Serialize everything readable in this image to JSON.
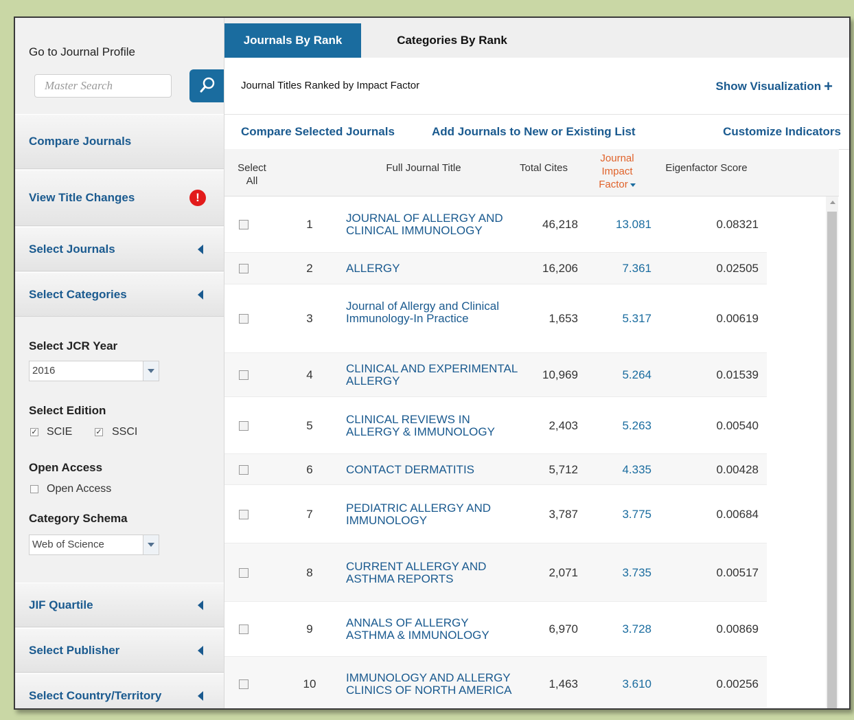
{
  "sidebar": {
    "goto_label": "Go to Journal Profile",
    "search_placeholder": "Master Search",
    "compare": "Compare Journals",
    "title_changes": "View Title Changes",
    "select_journals": "Select Journals",
    "select_categories": "Select Categories",
    "jcr_year_label": "Select JCR Year",
    "jcr_year_value": "2016",
    "edition_label": "Select Edition",
    "edition_scie": "SCIE",
    "edition_ssci": "SSCI",
    "open_access_label": "Open Access",
    "open_access_option": "Open Access",
    "schema_label": "Category Schema",
    "schema_value": "Web of Science",
    "jif_quartile": "JIF Quartile",
    "select_publisher": "Select Publisher",
    "select_country": "Select Country/Territory",
    "icons": {
      "search": "search-icon",
      "alert": "alert-icon",
      "collapse": "collapse-arrow-icon"
    }
  },
  "tabs": {
    "active": "Journals By Rank",
    "other": "Categories By Rank"
  },
  "subheader": {
    "title": "Journal Titles Ranked by Impact Factor",
    "show_vis": "Show Visualization"
  },
  "actions": {
    "compare_selected": "Compare Selected Journals",
    "add_to_list": "Add Journals to New or Existing List",
    "customize": "Customize Indicators"
  },
  "table": {
    "headers": {
      "select_all": "Select All",
      "title": "Full Journal Title",
      "cites": "Total Cites",
      "jif": "Journal Impact Factor",
      "eigen": "Eigenfactor Score"
    },
    "rows": [
      {
        "rank": "1",
        "title": "JOURNAL OF ALLERGY AND CLINICAL IMMUNOLOGY",
        "cites": "46,218",
        "jif": "13.081",
        "eigen": "0.08321"
      },
      {
        "rank": "2",
        "title": "ALLERGY",
        "cites": "16,206",
        "jif": "7.361",
        "eigen": "0.02505"
      },
      {
        "rank": "3",
        "title": "Journal of Allergy and Clinical Immunology-In Practice",
        "cites": "1,653",
        "jif": "5.317",
        "eigen": "0.00619"
      },
      {
        "rank": "4",
        "title": "CLINICAL AND EXPERIMENTAL ALLERGY",
        "cites": "10,969",
        "jif": "5.264",
        "eigen": "0.01539"
      },
      {
        "rank": "5",
        "title": "CLINICAL REVIEWS IN ALLERGY & IMMUNOLOGY",
        "cites": "2,403",
        "jif": "5.263",
        "eigen": "0.00540"
      },
      {
        "rank": "6",
        "title": "CONTACT DERMATITIS",
        "cites": "5,712",
        "jif": "4.335",
        "eigen": "0.00428"
      },
      {
        "rank": "7",
        "title": "PEDIATRIC ALLERGY AND IMMUNOLOGY",
        "cites": "3,787",
        "jif": "3.775",
        "eigen": "0.00684"
      },
      {
        "rank": "8",
        "title": "CURRENT ALLERGY AND ASTHMA REPORTS",
        "cites": "2,071",
        "jif": "3.735",
        "eigen": "0.00517"
      },
      {
        "rank": "9",
        "title": "ANNALS OF ALLERGY ASTHMA & IMMUNOLOGY",
        "cites": "6,970",
        "jif": "3.728",
        "eigen": "0.00869"
      },
      {
        "rank": "10",
        "title": "IMMUNOLOGY AND ALLERGY CLINICS OF NORTH AMERICA",
        "cites": "1,463",
        "jif": "3.610",
        "eigen": "0.00256"
      }
    ]
  },
  "colors": {
    "accent": "#1a6c9f",
    "link": "#1a5a8f",
    "sort_header": "#e0622a",
    "alert": "#e21b1b",
    "page_bg": "#c9d7a5"
  }
}
